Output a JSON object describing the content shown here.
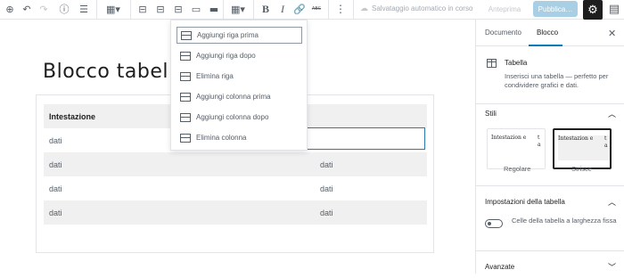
{
  "toolbar": {
    "icons": [
      "add-block",
      "undo",
      "redo",
      "info",
      "outline",
      "table",
      "align-left",
      "align-center",
      "align-right",
      "wide",
      "full",
      "edit-table",
      "bold",
      "italic",
      "link",
      "strikethrough",
      "more"
    ],
    "bold_label": "B",
    "italic_label": "I",
    "abc_label": "ABC",
    "saving_text": "Salvataggio automatico in corso",
    "preview_label": "Anteprima",
    "publish_label": "Pubblica…"
  },
  "editor": {
    "title": "Blocco tabella",
    "table": {
      "rows": [
        [
          "Intestazione",
          ""
        ],
        [
          "dati",
          ""
        ],
        [
          "dati",
          "dati"
        ],
        [
          "dati",
          "dati"
        ],
        [
          "dati",
          "dati"
        ]
      ]
    }
  },
  "menu": {
    "items": [
      "Aggiungi riga prima",
      "Aggiungi riga dopo",
      "Elimina riga",
      "Aggiungi colonna prima",
      "Aggiungi colonna dopo",
      "Elimina colonna"
    ],
    "active_index": 0
  },
  "sidebar": {
    "tabs": [
      "Documento",
      "Blocco"
    ],
    "active_tab": "Blocco",
    "block": {
      "title": "Tabella",
      "description": "Inserisci una tabella — perfetto per condividere grafici e dati."
    },
    "styles_heading": "Stili",
    "styles": [
      {
        "label": "Regolare",
        "preview_a": "Intestazion e",
        "preview_b": "t a"
      },
      {
        "label": "Strisce",
        "preview_a": "Intestazion e",
        "preview_b": "t a"
      }
    ],
    "settings_heading": "Impostazioni della tabella",
    "toggle_label": "Celle della tabella a larghezza fissa",
    "advanced_heading": "Avanzate"
  },
  "colors": {
    "accent": "#007cba",
    "publish": "#a8cfe4",
    "settings_bg": "#1e1e1e"
  }
}
